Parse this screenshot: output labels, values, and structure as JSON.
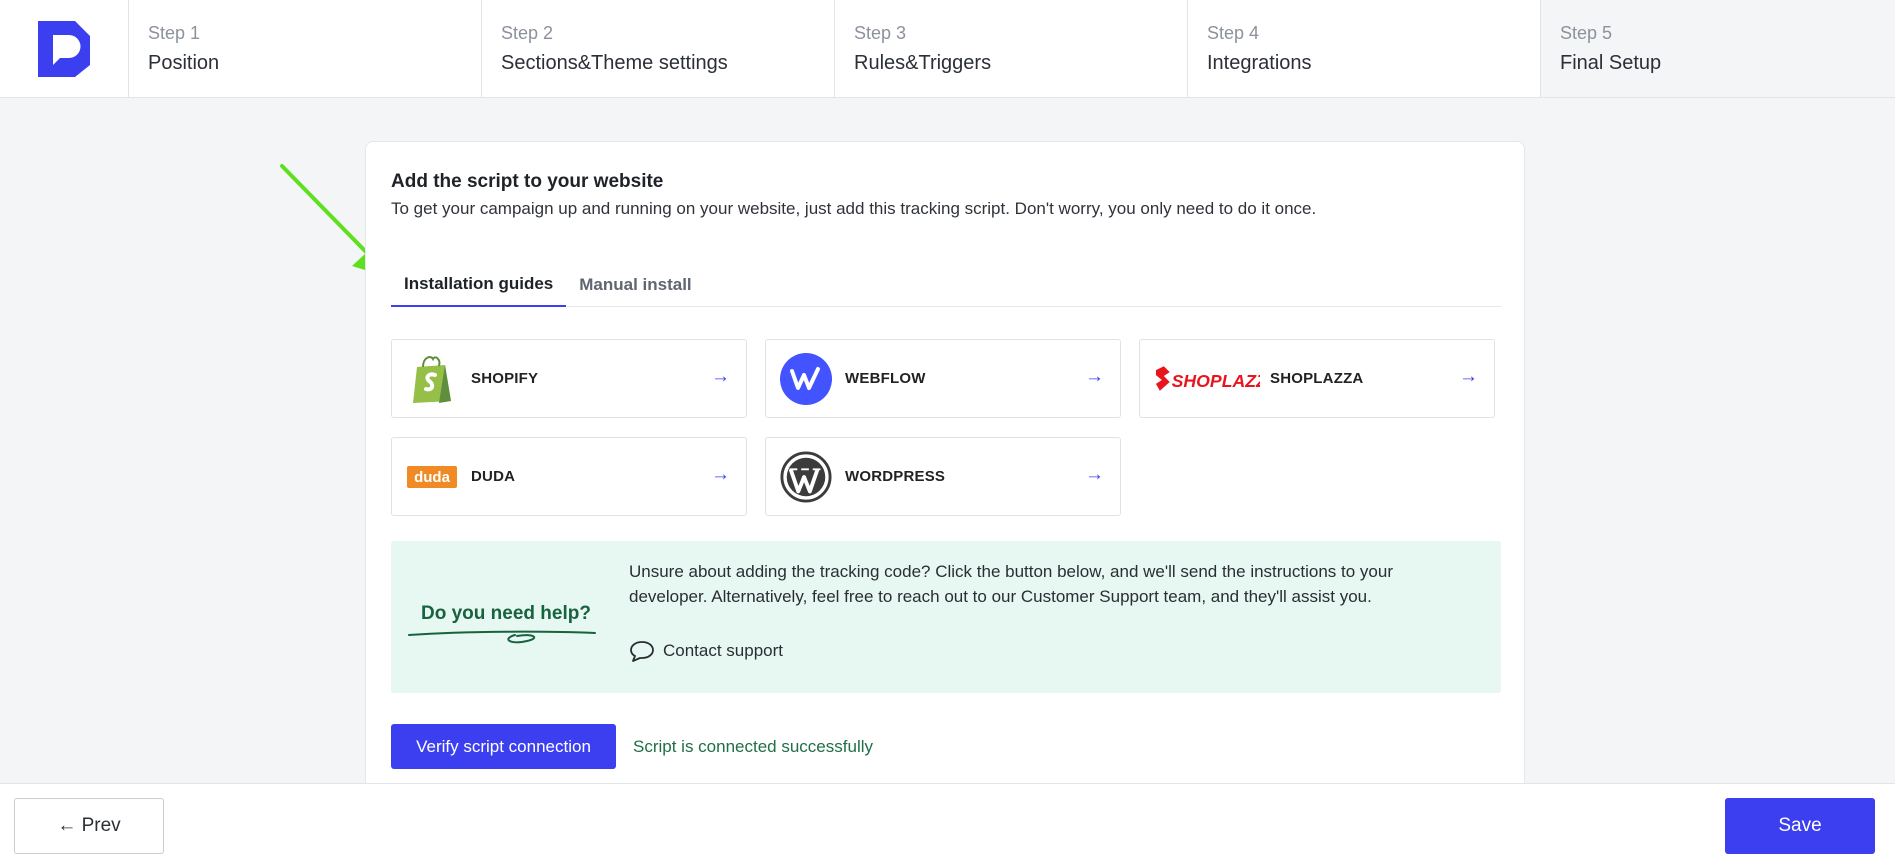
{
  "steps": [
    {
      "num": "Step 1",
      "title": "Position"
    },
    {
      "num": "Step 2",
      "title": "Sections&Theme settings"
    },
    {
      "num": "Step 3",
      "title": "Rules&Triggers"
    },
    {
      "num": "Step 4",
      "title": "Integrations"
    },
    {
      "num": "Step 5",
      "title": "Final Setup"
    }
  ],
  "card": {
    "title": "Add the script to your website",
    "subtitle": "To get your campaign up and running on your website, just add this tracking script. Don't worry, you only need to do it once."
  },
  "tabs": [
    {
      "label": "Installation guides",
      "active": true
    },
    {
      "label": "Manual install",
      "active": false
    }
  ],
  "platforms": [
    {
      "name": "SHOPIFY",
      "icon": "shopify-icon",
      "arrow": "→"
    },
    {
      "name": "WEBFLOW",
      "icon": "webflow-icon",
      "arrow": "→"
    },
    {
      "name": "SHOPLAZZA",
      "icon": "shoplazza-logo",
      "logo_text": "SHOPLAZZA",
      "arrow": "→"
    },
    {
      "name": "DUDA",
      "icon": "duda-logo",
      "logo_text": "duda",
      "arrow": "→"
    },
    {
      "name": "WORDPRESS",
      "icon": "wordpress-icon",
      "arrow": "→"
    }
  ],
  "help": {
    "title": "Do you need help?",
    "text": "Unsure about adding the tracking code? Click the button below, and we'll send the instructions to your developer. Alternatively, feel free to reach out to our Customer Support team, and they'll assist you.",
    "contact_label": "Contact support"
  },
  "verify": {
    "button_label": "Verify script connection",
    "status": "Script is connected successfully"
  },
  "footer": {
    "prev_label": "← Prev",
    "save_label": "Save"
  },
  "colors": {
    "accent": "#3b3ff0",
    "success": "#1f6f47",
    "help_bg": "#e7f7f1",
    "annotation_arrow": "#5ee01e"
  }
}
